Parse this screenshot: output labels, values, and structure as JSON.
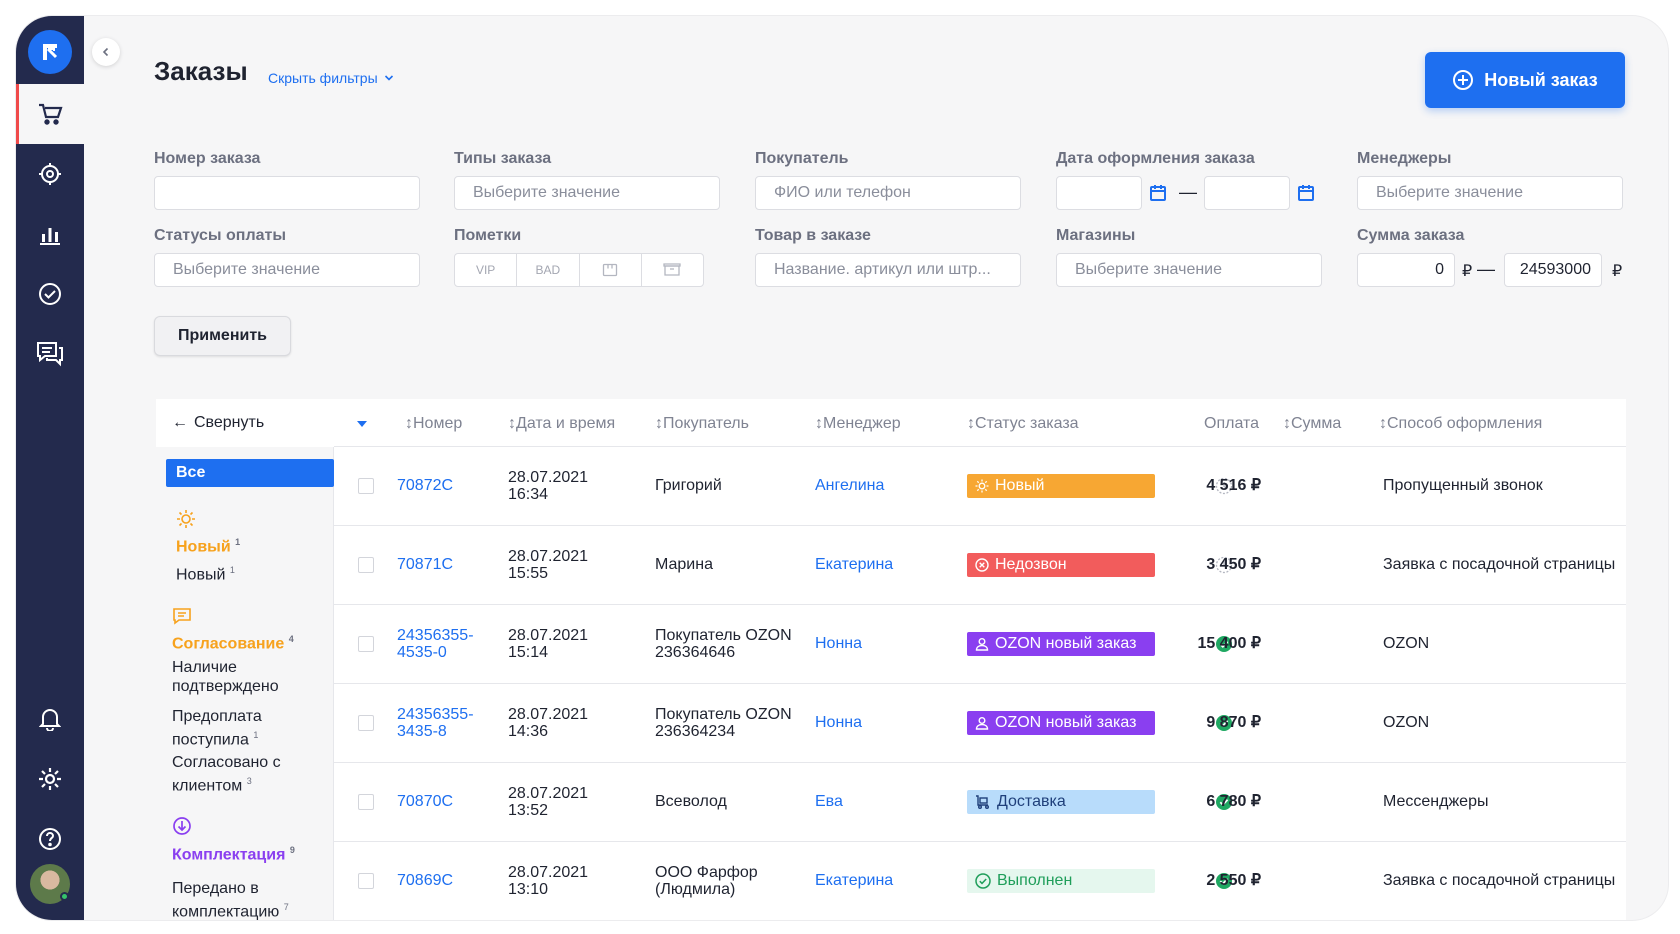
{
  "page": {
    "title": "Заказы",
    "hide_filters": "Скрыть фильтры",
    "new_order": "Новый заказ"
  },
  "filters": {
    "order_number": {
      "label": "Номер заказа",
      "value": ""
    },
    "order_types": {
      "label": "Типы заказа",
      "placeholder": "Выберите значение"
    },
    "buyer": {
      "label": "Покупатель",
      "placeholder": "ФИО или телефон"
    },
    "order_date": {
      "label": "Дата оформления заказа",
      "from": "",
      "to": "",
      "separator": "—"
    },
    "managers": {
      "label": "Менеджеры",
      "placeholder": "Выберите значение"
    },
    "payment_status": {
      "label": "Статусы оплаты",
      "placeholder": "Выберите значение"
    },
    "marks": {
      "label": "Пометки",
      "tags": [
        "VIP",
        "BAD"
      ]
    },
    "product": {
      "label": "Товар в заказе",
      "placeholder": "Название. артикул или штр..."
    },
    "shops": {
      "label": "Магазины",
      "placeholder": "Выберите значение"
    },
    "sum": {
      "label": "Сумма заказа",
      "from": "0",
      "to": "24593000",
      "currency": "₽",
      "separator": "—"
    },
    "apply": "Применить"
  },
  "groups": {
    "collapse": "Свернуть",
    "all": "Все",
    "items": [
      {
        "title": "Новый",
        "count": "1",
        "color": "#f7a21d",
        "subs": [
          {
            "label": "Новый",
            "count": "1"
          }
        ]
      },
      {
        "title": "Согласование",
        "count": "4",
        "color": "#f7a21d",
        "subs": [
          {
            "label": "Наличие подтверждено",
            "count": ""
          },
          {
            "label": "Предоплата поступила",
            "count": "1"
          },
          {
            "label": "Согласовано с клиентом",
            "count": "3"
          }
        ]
      },
      {
        "title": "Комплектация",
        "count": "9",
        "color": "#8a3ff0",
        "subs": [
          {
            "label": "Передано в комплектацию",
            "count": "7"
          }
        ]
      }
    ]
  },
  "table": {
    "columns": [
      "Номер",
      "Дата и время",
      "Покупатель",
      "Менеджер",
      "Статус заказа",
      "Оплата",
      "Сумма",
      "Способ оформления"
    ],
    "rows": [
      {
        "number": [
          "70872C"
        ],
        "date": "28.07.2021",
        "time": "16:34",
        "buyer": [
          "Григорий"
        ],
        "manager": "Ангелина",
        "status": "Новый",
        "status_color": "#f7a733",
        "status_text_color": "#ffffff",
        "paid": false,
        "sum": "4 516 ₽",
        "method": "Пропущенный звонок"
      },
      {
        "number": [
          "70871C"
        ],
        "date": "28.07.2021",
        "time": "15:55",
        "buyer": [
          "Марина"
        ],
        "manager": "Екатерина",
        "status": "Недозвон",
        "status_color": "#f25c5c",
        "status_text_color": "#ffffff",
        "paid": false,
        "sum": "3 450 ₽",
        "method": "Заявка с посадочной страницы"
      },
      {
        "number": [
          "24356355-",
          "4535-0"
        ],
        "date": "28.07.2021",
        "time": "15:14",
        "buyer": [
          "Покупатель OZON",
          "236364646"
        ],
        "manager": "Нонна",
        "status": "OZON новый заказ",
        "status_color": "#8a3ff0",
        "status_text_color": "#ffffff",
        "paid": true,
        "sum": "15 400 ₽",
        "method": "OZON"
      },
      {
        "number": [
          "24356355-",
          "3435-8"
        ],
        "date": "28.07.2021",
        "time": "14:36",
        "buyer": [
          "Покупатель OZON",
          "236364234"
        ],
        "manager": "Нонна",
        "status": "OZON новый заказ",
        "status_color": "#8a3ff0",
        "status_text_color": "#ffffff",
        "paid": true,
        "sum": "9 870 ₽",
        "method": "OZON"
      },
      {
        "number": [
          "70870C"
        ],
        "date": "28.07.2021",
        "time": "13:52",
        "buyer": [
          "Всеволод"
        ],
        "manager": "Ева",
        "status": "Доставка",
        "status_color": "#b8dcfb",
        "status_text_color": "#1f3f7a",
        "paid": true,
        "sum": "6 780 ₽",
        "method": "Мессенджеры"
      },
      {
        "number": [
          "70869C"
        ],
        "date": "28.07.2021",
        "time": "13:10",
        "buyer": [
          "ООО Фарфор",
          "(Людмила)"
        ],
        "manager": "Екатерина",
        "status": "Выполнен",
        "status_color": "#e5f7ee",
        "status_text_color": "#1f9e5a",
        "paid": true,
        "sum": "2 550 ₽",
        "method": "Заявка с посадочной страницы"
      }
    ]
  },
  "colors": {
    "accent": "#1e6ff0",
    "sidebar": "#232a4d",
    "paid": "#1fa862"
  }
}
